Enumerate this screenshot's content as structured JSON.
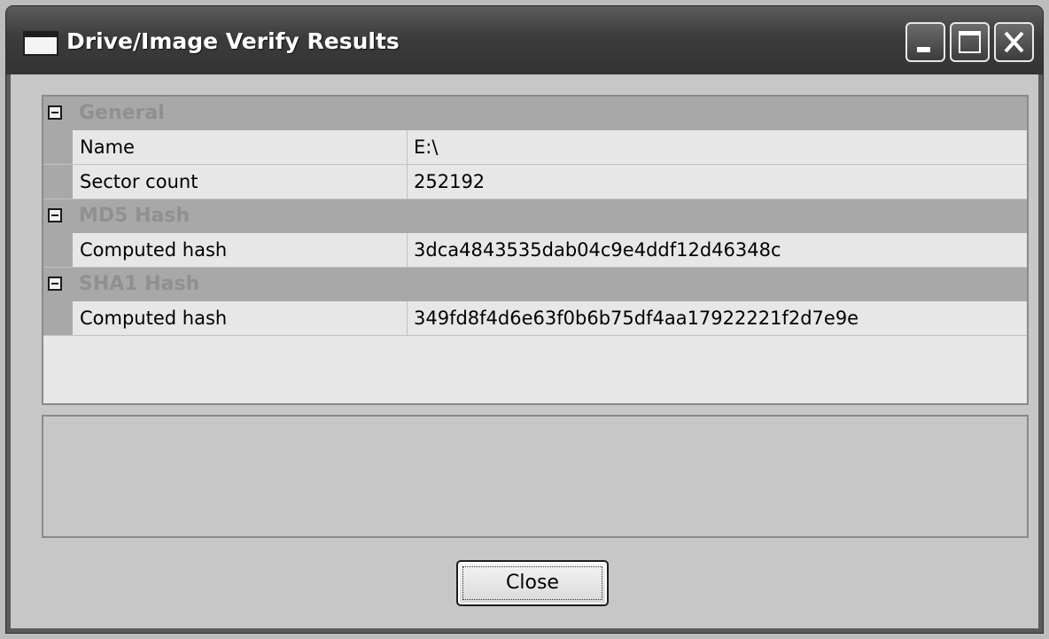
{
  "window": {
    "title": "Drive/Image Verify Results"
  },
  "title_buttons": [
    "minimize",
    "maximize",
    "close"
  ],
  "property_grid": {
    "categories": [
      {
        "label": "General",
        "expanded": true,
        "properties": [
          {
            "name": "Name",
            "value": "E:\\"
          },
          {
            "name": "Sector count",
            "value": "252192"
          }
        ]
      },
      {
        "label": "MD5 Hash",
        "expanded": true,
        "properties": [
          {
            "name": "Computed hash",
            "value": "3dca4843535dab04c9e4ddf12d46348c"
          }
        ]
      },
      {
        "label": "SHA1 Hash",
        "expanded": true,
        "properties": [
          {
            "name": "Computed hash",
            "value": "349fd8f4d6e63f0b6b75df4aa17922221f2d7e9e"
          }
        ]
      }
    ]
  },
  "description_panel": {
    "text": ""
  },
  "actions": {
    "close_label": "Close"
  },
  "icons": {
    "app": "window-icon",
    "category_toggle": "collapse-icon"
  },
  "colors": {
    "titlebar": "#3c3c3c",
    "title_text": "#ffffff",
    "client_background": "#c7c7c7",
    "category_row": "#a8a8a8",
    "category_text": "#909090",
    "grid_background": "#e7e7e7"
  }
}
